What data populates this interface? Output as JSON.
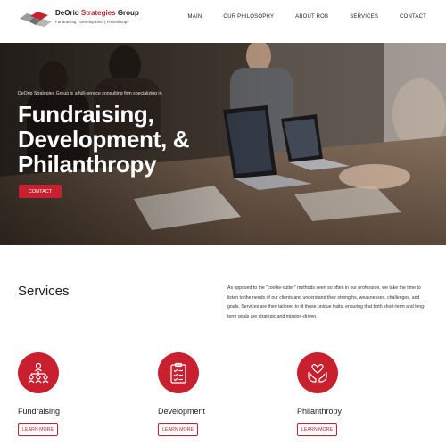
{
  "logo": {
    "name_part1": "DeOrio",
    "name_accent": "Strategies",
    "name_part2": "Group",
    "tagline": "Fundraising  |  Development  |  Philanthropy"
  },
  "nav": {
    "items": [
      "MAIN",
      "OUR PHILOSOPHY",
      "ABOUT ROB",
      "SERVICES",
      "CONTACT"
    ]
  },
  "hero": {
    "tagline": "DeOrio Strategies Group is a full-service consulting firm specializing in",
    "title_line1": "Fundraising,",
    "title_line2": "Development, &",
    "title_line3": "Philanthropy",
    "cta_label": "CONTACT"
  },
  "services": {
    "title": "Services",
    "description": "As opposed to the \"cookie-cutter\" methods seen so often in our profession, we take the time to listen to the needs of our clients and understand their strengths, weaknesses, challenges, and goals. Services are then tailored to fit those unique traits, ensuring that both short-term and long-term goals are strategic and mission-driven.",
    "cards": [
      {
        "name": "Fundraising",
        "button": "LEARN MORE",
        "icon": "people-network-icon"
      },
      {
        "name": "Development",
        "button": "LEARN MORE",
        "icon": "clipboard-checklist-icon"
      },
      {
        "name": "Philanthropy",
        "button": "LEARN MORE",
        "icon": "hands-heart-icon"
      }
    ]
  },
  "colors": {
    "accent": "#c8202f",
    "text": "#222222",
    "background": "#ffffff"
  }
}
